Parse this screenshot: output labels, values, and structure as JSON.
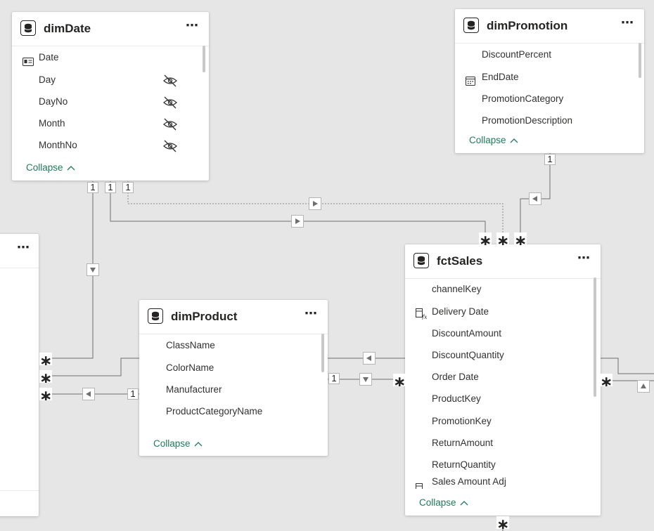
{
  "tables": {
    "dimDate": {
      "title": "dimDate",
      "fields": [
        "Date",
        "Day",
        "DayNo",
        "Month",
        "MonthNo"
      ],
      "collapse_label": "Collapse"
    },
    "dimPromotion": {
      "title": "dimPromotion",
      "fields": [
        "DiscountPercent",
        "EndDate",
        "PromotionCategory",
        "PromotionDescription"
      ],
      "collapse_label": "Collapse"
    },
    "dimProduct": {
      "title": "dimProduct",
      "fields": [
        "ClassName",
        "ColorName",
        "Manufacturer",
        "ProductCategoryName"
      ],
      "collapse_label": "Collapse"
    },
    "fctSales": {
      "title": "fctSales",
      "fields": [
        "channelKey",
        "Delivery Date",
        "DiscountAmount",
        "DiscountQuantity",
        "Order Date",
        "ProductKey",
        "PromotionKey",
        "ReturnAmount",
        "ReturnQuantity",
        "Sales Amount Adj"
      ],
      "collapse_label": "Collapse"
    },
    "left_partial": {
      "more_label": "⋯"
    }
  },
  "more_label": "⋯",
  "cardinality": {
    "one": "1",
    "many": "∗"
  },
  "colors": {
    "canvas": "#e6e6e6",
    "accent": "#1e7b58",
    "line": "#6f6f6f"
  },
  "icons": [
    "table-icon",
    "more-options-icon",
    "hidden-eye-icon",
    "id-card-icon",
    "calendar-icon",
    "calculated-column-icon",
    "chevron-up-icon",
    "filter-direction-arrow-icon"
  ]
}
